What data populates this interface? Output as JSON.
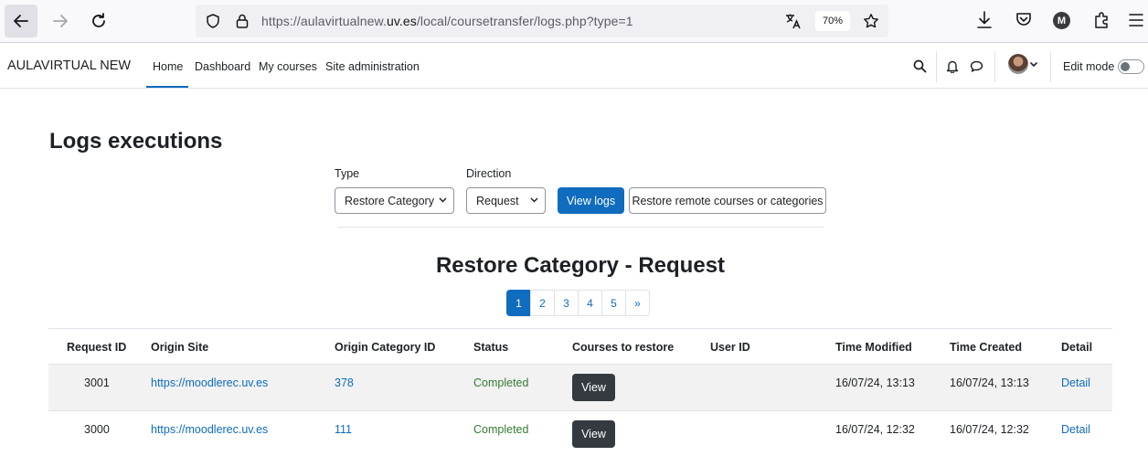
{
  "browser": {
    "url_prefix": "https://aulavirtualnew.",
    "url_domain": "uv.es",
    "url_suffix": "/local/coursetransfer/logs.php?type=1",
    "zoom": "70%",
    "profile_initial": "M"
  },
  "navbar": {
    "brand": "AULAVIRTUAL NEW",
    "menu": [
      "Home",
      "Dashboard",
      "My courses",
      "Site administration"
    ],
    "edit_mode_label": "Edit mode"
  },
  "page": {
    "title": "Logs executions",
    "type_label": "Type",
    "type_value": "Restore Category",
    "direction_label": "Direction",
    "direction_value": "Request",
    "view_logs_button": "View logs",
    "restore_button": "Restore remote courses or categories",
    "section_title": "Restore Category - Request"
  },
  "pagination": [
    "1",
    "2",
    "3",
    "4",
    "5",
    "»"
  ],
  "table": {
    "headers": [
      "Request ID",
      "Origin Site",
      "Origin Category ID",
      "Status",
      "Courses to restore",
      "User ID",
      "Time Modified",
      "Time Created",
      "Detail"
    ],
    "rows": [
      {
        "request_id": "3001",
        "origin_site": "https://moodlerec.uv.es",
        "origin_category_id": "378",
        "status": "Completed",
        "courses_button": "View",
        "user_id": "",
        "time_modified": "16/07/24, 13:13",
        "time_created": "16/07/24, 13:13",
        "detail": "Detail"
      },
      {
        "request_id": "3000",
        "origin_site": "https://moodlerec.uv.es",
        "origin_category_id": "111",
        "status": "Completed",
        "courses_button": "View",
        "user_id": "",
        "time_modified": "16/07/24, 12:32",
        "time_created": "16/07/24, 12:32",
        "detail": "Detail"
      }
    ]
  },
  "colors": {
    "primary": "#0f6cbf",
    "success": "#357a32",
    "dark_button": "#343a40",
    "striped_row": "#f2f2f2"
  }
}
